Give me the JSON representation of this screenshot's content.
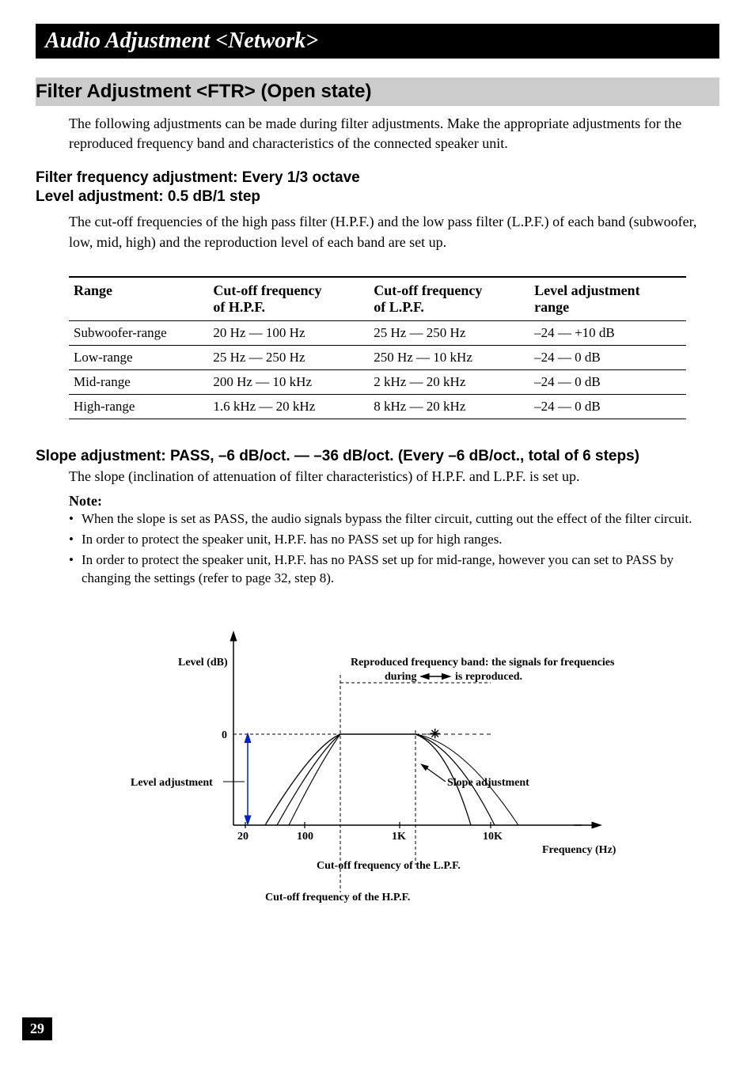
{
  "title_bar": "Audio Adjustment <Network>",
  "section_header": "Filter Adjustment <FTR> (Open state)",
  "intro": "The following adjustments can be made during filter adjustments. Make the appropriate adjustments for the reproduced frequency band and characteristics of the connected speaker unit.",
  "subheading1": "Filter frequency adjustment: Every 1/3 octave",
  "subheading2": "Level adjustment: 0.5 dB/1 step",
  "body1": "The cut-off frequencies of the high pass filter (H.P.F.) and the low pass filter (L.P.F.) of each band (subwoofer, low, mid, high) and the reproduction level of each band are set up.",
  "table": {
    "headers": [
      "Range",
      "Cut-off frequency of H.P.F.",
      "Cut-off frequency of L.P.F.",
      "Level adjustment range"
    ],
    "rows": [
      [
        "Subwoofer-range",
        "20 Hz — 100 Hz",
        "25 Hz — 250 Hz",
        "–24 — +10 dB"
      ],
      [
        "Low-range",
        "25 Hz — 250 Hz",
        "250 Hz — 10 kHz",
        "–24 — 0 dB"
      ],
      [
        "Mid-range",
        "200 Hz — 10 kHz",
        "2 kHz — 20 kHz",
        "–24 — 0 dB"
      ],
      [
        "High-range",
        "1.6 kHz — 20 kHz",
        "8 kHz — 20 kHz",
        "–24 — 0 dB"
      ]
    ]
  },
  "slope_heading": "Slope adjustment: PASS, –6 dB/oct. — –36 dB/oct. (Every –6 dB/oct., total of 6 steps)",
  "slope_body": "The slope (inclination of attenuation of filter characteristics) of H.P.F. and L.P.F. is set up.",
  "note_label": "Note:",
  "notes": [
    "When the slope is set as PASS, the audio signals bypass the filter circuit, cutting out the effect of the filter circuit.",
    "In order to protect the speaker unit, H.P.F. has no PASS set up for high ranges.",
    "In order to protect the speaker unit, H.P.F. has no PASS set up for mid-range, however you can set to PASS by changing the settings (refer to page 32, step 8)."
  ],
  "diagram": {
    "level_label": "Level (dB)",
    "zero": "0",
    "level_adj": "Level adjustment",
    "freq_20": "20",
    "freq_100": "100",
    "freq_1k": "1K",
    "freq_10k": "10K",
    "freq_label": "Frequency (Hz)",
    "slope_adj": "Slope adjustment",
    "band_text1": "Reproduced frequency band: the signals for frequencies",
    "band_text2": "during",
    "band_text3": "is reproduced.",
    "cutoff_lpf": "Cut-off frequency of the L.P.F.",
    "cutoff_hpf": "Cut-off frequency of the H.P.F."
  },
  "page": "29"
}
